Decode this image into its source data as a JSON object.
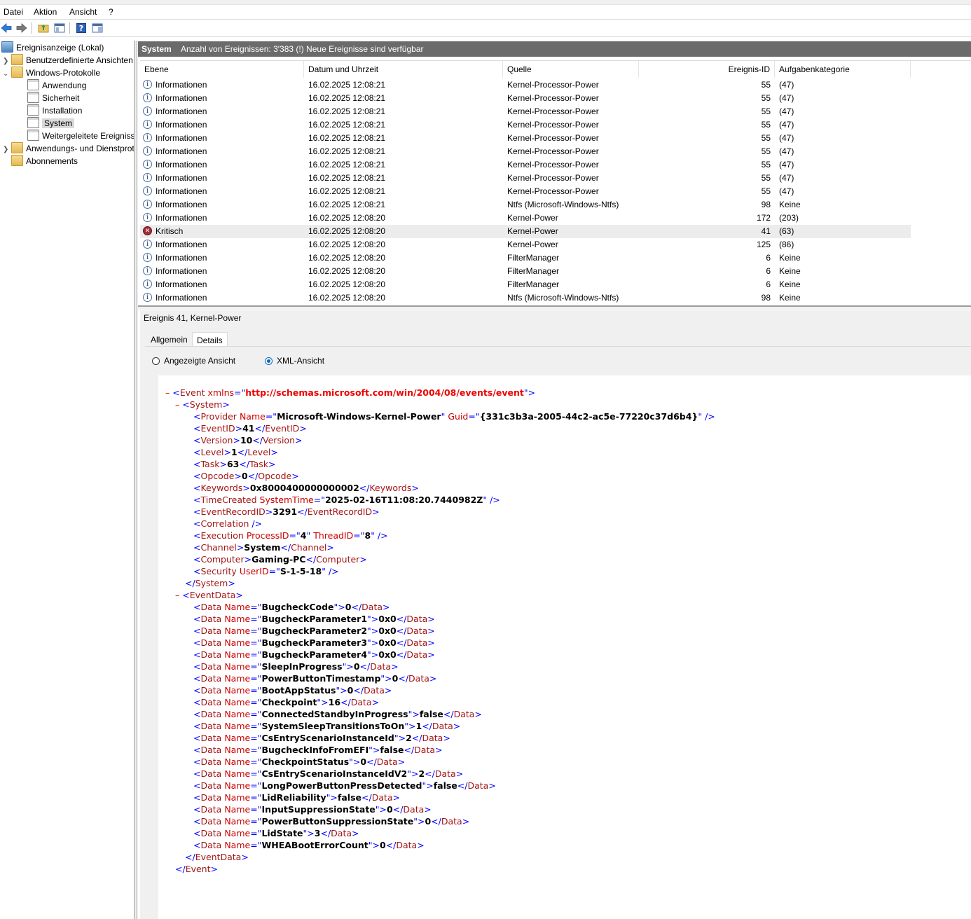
{
  "menu": [
    "Datei",
    "Aktion",
    "Ansicht",
    "?"
  ],
  "toolbar": {
    "icons": [
      "back-arrow-icon",
      "forward-arrow-icon",
      "folder-up-icon",
      "console-tree-icon",
      "help-icon",
      "action-pane-icon"
    ]
  },
  "tree": {
    "root": "Ereignisanzeige (Lokal)",
    "custom_views": "Benutzerdefinierte Ansichten",
    "windows_logs": "Windows-Protokolle",
    "logs": [
      "Anwendung",
      "Sicherheit",
      "Installation",
      "System",
      "Weitergeleitete Ereignisse"
    ],
    "app_service": "Anwendungs- und Dienstprotokolle",
    "subscriptions": "Abonnements"
  },
  "header": {
    "log_name": "System",
    "summary": "Anzahl von Ereignissen: 3'383 (!) Neue Ereignisse sind verfügbar"
  },
  "grid": {
    "columns": [
      "Ebene",
      "Datum und Uhrzeit",
      "Quelle",
      "Ereignis-ID",
      "Aufgabenkategorie"
    ],
    "rows": [
      [
        "Informationen",
        "16.02.2025 12:08:21",
        "Kernel-Processor-Power",
        "55",
        "(47)"
      ],
      [
        "Informationen",
        "16.02.2025 12:08:21",
        "Kernel-Processor-Power",
        "55",
        "(47)"
      ],
      [
        "Informationen",
        "16.02.2025 12:08:21",
        "Kernel-Processor-Power",
        "55",
        "(47)"
      ],
      [
        "Informationen",
        "16.02.2025 12:08:21",
        "Kernel-Processor-Power",
        "55",
        "(47)"
      ],
      [
        "Informationen",
        "16.02.2025 12:08:21",
        "Kernel-Processor-Power",
        "55",
        "(47)"
      ],
      [
        "Informationen",
        "16.02.2025 12:08:21",
        "Kernel-Processor-Power",
        "55",
        "(47)"
      ],
      [
        "Informationen",
        "16.02.2025 12:08:21",
        "Kernel-Processor-Power",
        "55",
        "(47)"
      ],
      [
        "Informationen",
        "16.02.2025 12:08:21",
        "Kernel-Processor-Power",
        "55",
        "(47)"
      ],
      [
        "Informationen",
        "16.02.2025 12:08:21",
        "Kernel-Processor-Power",
        "55",
        "(47)"
      ],
      [
        "Informationen",
        "16.02.2025 12:08:21",
        "Ntfs (Microsoft-Windows-Ntfs)",
        "98",
        "Keine"
      ],
      [
        "Informationen",
        "16.02.2025 12:08:20",
        "Kernel-Power",
        "172",
        "(203)"
      ],
      [
        "Kritisch",
        "16.02.2025 12:08:20",
        "Kernel-Power",
        "41",
        "(63)"
      ],
      [
        "Informationen",
        "16.02.2025 12:08:20",
        "Kernel-Power",
        "125",
        "(86)"
      ],
      [
        "Informationen",
        "16.02.2025 12:08:20",
        "FilterManager",
        "6",
        "Keine"
      ],
      [
        "Informationen",
        "16.02.2025 12:08:20",
        "FilterManager",
        "6",
        "Keine"
      ],
      [
        "Informationen",
        "16.02.2025 12:08:20",
        "FilterManager",
        "6",
        "Keine"
      ],
      [
        "Informationen",
        "16.02.2025 12:08:20",
        "Ntfs (Microsoft-Windows-Ntfs)",
        "98",
        "Keine"
      ]
    ]
  },
  "detail": {
    "title": "Ereignis 41, Kernel-Power",
    "tabs": [
      "Allgemein",
      "Details"
    ],
    "view_options": [
      "Angezeigte Ansicht",
      "XML-Ansicht"
    ],
    "selected_view": "XML-Ansicht",
    "xml": {
      "event_ns": "http://schemas.microsoft.com/win/2004/08/events/event",
      "provider_name": "Microsoft-Windows-Kernel-Power",
      "provider_guid": "{331c3b3a-2005-44c2-ac5e-77220c37d6b4}",
      "system_fields": [
        [
          "EventID",
          "41"
        ],
        [
          "Version",
          "10"
        ],
        [
          "Level",
          "1"
        ],
        [
          "Task",
          "63"
        ],
        [
          "Opcode",
          "0"
        ],
        [
          "Keywords",
          "0x8000400000000002"
        ]
      ],
      "time_created": "2025-02-16T11:08:20.7440982Z",
      "event_record_id": "3291",
      "process_id": "4",
      "thread_id": "8",
      "channel": "System",
      "computer": "Gaming-PC",
      "user_id": "S-1-5-18",
      "event_data": [
        [
          "BugcheckCode",
          "0"
        ],
        [
          "BugcheckParameter1",
          "0x0"
        ],
        [
          "BugcheckParameter2",
          "0x0"
        ],
        [
          "BugcheckParameter3",
          "0x0"
        ],
        [
          "BugcheckParameter4",
          "0x0"
        ],
        [
          "SleepInProgress",
          "0"
        ],
        [
          "PowerButtonTimestamp",
          "0"
        ],
        [
          "BootAppStatus",
          "0"
        ],
        [
          "Checkpoint",
          "16"
        ],
        [
          "ConnectedStandbyInProgress",
          "false"
        ],
        [
          "SystemSleepTransitionsToOn",
          "1"
        ],
        [
          "CsEntryScenarioInstanceId",
          "2"
        ],
        [
          "BugcheckInfoFromEFI",
          "false"
        ],
        [
          "CheckpointStatus",
          "0"
        ],
        [
          "CsEntryScenarioInstanceIdV2",
          "2"
        ],
        [
          "LongPowerButtonPressDetected",
          "false"
        ],
        [
          "LidReliability",
          "false"
        ],
        [
          "InputSuppressionState",
          "0"
        ],
        [
          "PowerButtonSuppressionState",
          "0"
        ],
        [
          "LidState",
          "3"
        ],
        [
          "WHEABootErrorCount",
          "0"
        ]
      ]
    }
  }
}
